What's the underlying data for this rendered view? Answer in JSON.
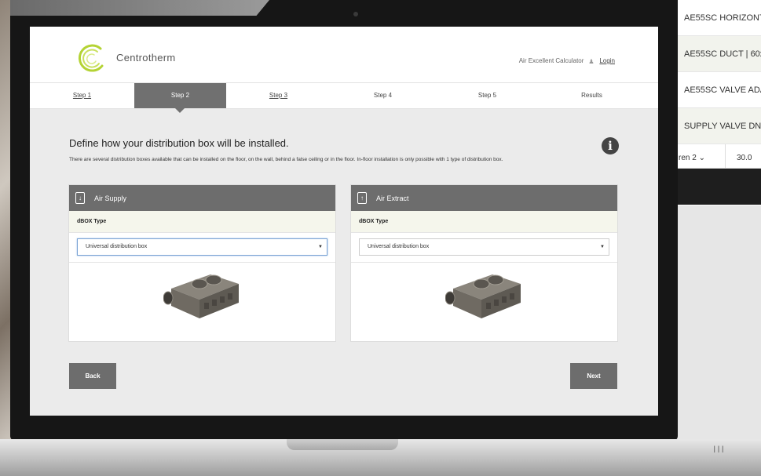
{
  "app": {
    "brand": "Centrotherm",
    "calculator_link": "Air Excellent Calculator",
    "login": "Login"
  },
  "steps": [
    "Step 1",
    "Step 2",
    "Step 3",
    "Step 4",
    "Step 5",
    "Results"
  ],
  "active_step": "Step 2",
  "main": {
    "heading": "Define how your distribution box will be installed.",
    "description": "There are several distribution boxes available that can be installed on the floor, on the wall, behind a false ceiling or in the floor. In-floor installation is only possible with 1 type of distribution box."
  },
  "panels": {
    "supply": {
      "title": "Air Supply",
      "subtitle": "dBOX Type",
      "selected": "Universal distribution box"
    },
    "extract": {
      "title": "Air Extract",
      "subtitle": "dBOX Type",
      "selected": "Universal distribution box"
    }
  },
  "buttons": {
    "back": "Back",
    "next": "Next"
  },
  "side_table": {
    "rows": [
      "AE55SC HORIZONT",
      "AE55SC DUCT | 60x",
      "AE55SC VALVE ADA",
      "SUPPLY VALVE DN"
    ],
    "bottom_left": "ren 2  ⌄",
    "bottom_right": "30.0"
  },
  "laptop": {
    "vents": "III"
  },
  "colors": {
    "accent_gray": "#6d6d6d",
    "logo_green": "#b4d334"
  }
}
